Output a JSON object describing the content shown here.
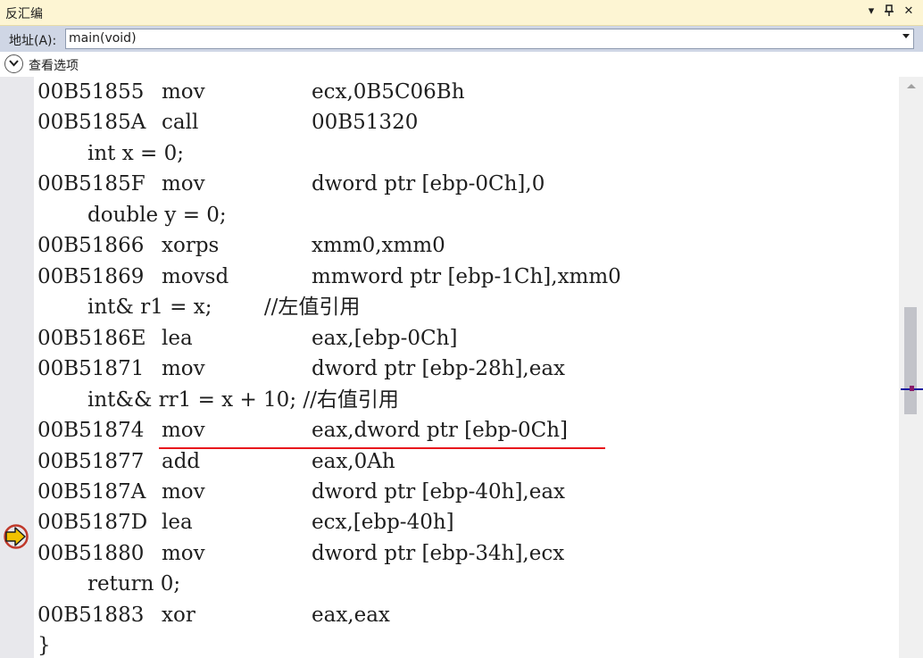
{
  "window": {
    "title": "反汇编",
    "dropdown_icon": "▾",
    "pin_icon": "📌",
    "close_icon": "✕"
  },
  "address": {
    "label": "地址(A):",
    "value": "main(void)"
  },
  "options": {
    "label": "查看选项"
  },
  "code_lines": [
    {
      "kind": "asm",
      "addr": "00B51855",
      "mnemonic": "mov",
      "operands": "ecx,0B5C06Bh"
    },
    {
      "kind": "asm",
      "addr": "00B5185A",
      "mnemonic": "call",
      "operands": "00B51320"
    },
    {
      "kind": "src",
      "text": "int x = 0;"
    },
    {
      "kind": "asm",
      "addr": "00B5185F",
      "mnemonic": "mov",
      "operands": "dword ptr [ebp-0Ch],0"
    },
    {
      "kind": "src",
      "text": "double y = 0;"
    },
    {
      "kind": "asm",
      "addr": "00B51866",
      "mnemonic": "xorps",
      "operands": "xmm0,xmm0"
    },
    {
      "kind": "asm",
      "addr": "00B51869",
      "mnemonic": "movsd",
      "operands": "mmword ptr [ebp-1Ch],xmm0"
    },
    {
      "kind": "src",
      "text": "int& r1 = x;        //左值引用"
    },
    {
      "kind": "asm",
      "addr": "00B5186E",
      "mnemonic": "lea",
      "operands": "eax,[ebp-0Ch]"
    },
    {
      "kind": "asm",
      "addr": "00B51871",
      "mnemonic": "mov",
      "operands": "dword ptr [ebp-28h],eax"
    },
    {
      "kind": "src",
      "text": "int&& rr1 = x + 10; //右值引用"
    },
    {
      "kind": "asm",
      "addr": "00B51874",
      "mnemonic": "mov",
      "operands": "eax,dword ptr [ebp-0Ch]"
    },
    {
      "kind": "asm",
      "addr": "00B51877",
      "mnemonic": "add",
      "operands": "eax,0Ah"
    },
    {
      "kind": "asm",
      "addr": "00B5187A",
      "mnemonic": "mov",
      "operands": "dword ptr [ebp-40h],eax"
    },
    {
      "kind": "asm",
      "addr": "00B5187D",
      "mnemonic": "lea",
      "operands": "ecx,[ebp-40h]"
    },
    {
      "kind": "asm",
      "addr": "00B51880",
      "mnemonic": "mov",
      "operands": "dword ptr [ebp-34h],ecx"
    },
    {
      "kind": "src",
      "text": "return 0;"
    },
    {
      "kind": "asm",
      "addr": "00B51883",
      "mnemonic": "xor",
      "operands": "eax,eax"
    },
    {
      "kind": "src0",
      "text": "}"
    }
  ],
  "colors": {
    "title_bg": "#fdf5d3",
    "address_bar_bg": "#cfd6e5",
    "underline": "#e8141c",
    "instruction_pointer": "#f2c200"
  }
}
